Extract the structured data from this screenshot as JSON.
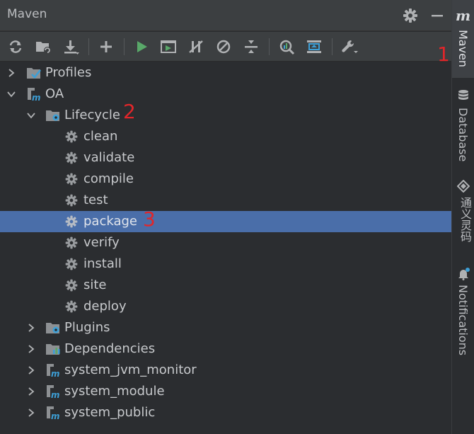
{
  "header": {
    "title": "Maven"
  },
  "toolbar": {
    "buttons": [
      "reload-icon",
      "folder-sync-icon",
      "download-icon",
      "add-icon",
      "run-icon",
      "execute-goal-icon",
      "toggle-offline-icon",
      "skip-tests-icon",
      "collapse-icon",
      "analyze-icon",
      "show-dependencies-icon",
      "settings-wrench-icon"
    ]
  },
  "tree": {
    "profiles": "Profiles",
    "project": "OA",
    "lifecycle": "Lifecycle",
    "goals": [
      "clean",
      "validate",
      "compile",
      "test",
      "package",
      "verify",
      "install",
      "site",
      "deploy"
    ],
    "plugins": "Plugins",
    "dependencies": "Dependencies",
    "modules": [
      "system_jvm_monitor",
      "system_module",
      "system_public"
    ]
  },
  "annotations": {
    "a1": "1",
    "a2": "2",
    "a3": "3"
  },
  "sidebar": {
    "maven_logo": "m",
    "tabs": [
      "Maven",
      "Database",
      "通义灵码",
      "Notifications"
    ]
  },
  "colors": {
    "selection": "#4a6ea9",
    "run_green": "#59a869",
    "maven_blue": "#3d9fd6",
    "annotation_red": "#e1262a"
  }
}
